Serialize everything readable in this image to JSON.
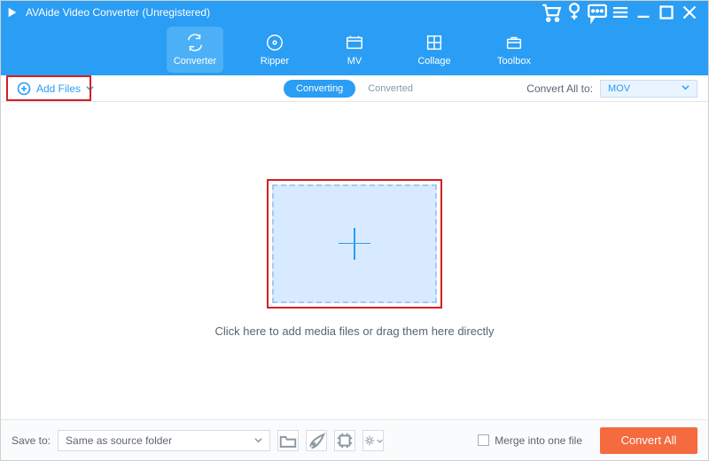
{
  "titlebar": {
    "title": "AVAide Video Converter (Unregistered)"
  },
  "tabs": {
    "converter": "Converter",
    "ripper": "Ripper",
    "mv": "MV",
    "collage": "Collage",
    "toolbox": "Toolbox"
  },
  "secbar": {
    "add_files": "Add Files",
    "sub_converting": "Converting",
    "sub_converted": "Converted",
    "convert_all_to_label": "Convert All to:",
    "convert_all_to_value": "MOV"
  },
  "main": {
    "hint": "Click here to add media files or drag them here directly"
  },
  "bottom": {
    "save_to_label": "Save to:",
    "save_to_value": "Same as source folder",
    "merge_label": "Merge into one file",
    "convert_all_btn": "Convert All"
  }
}
